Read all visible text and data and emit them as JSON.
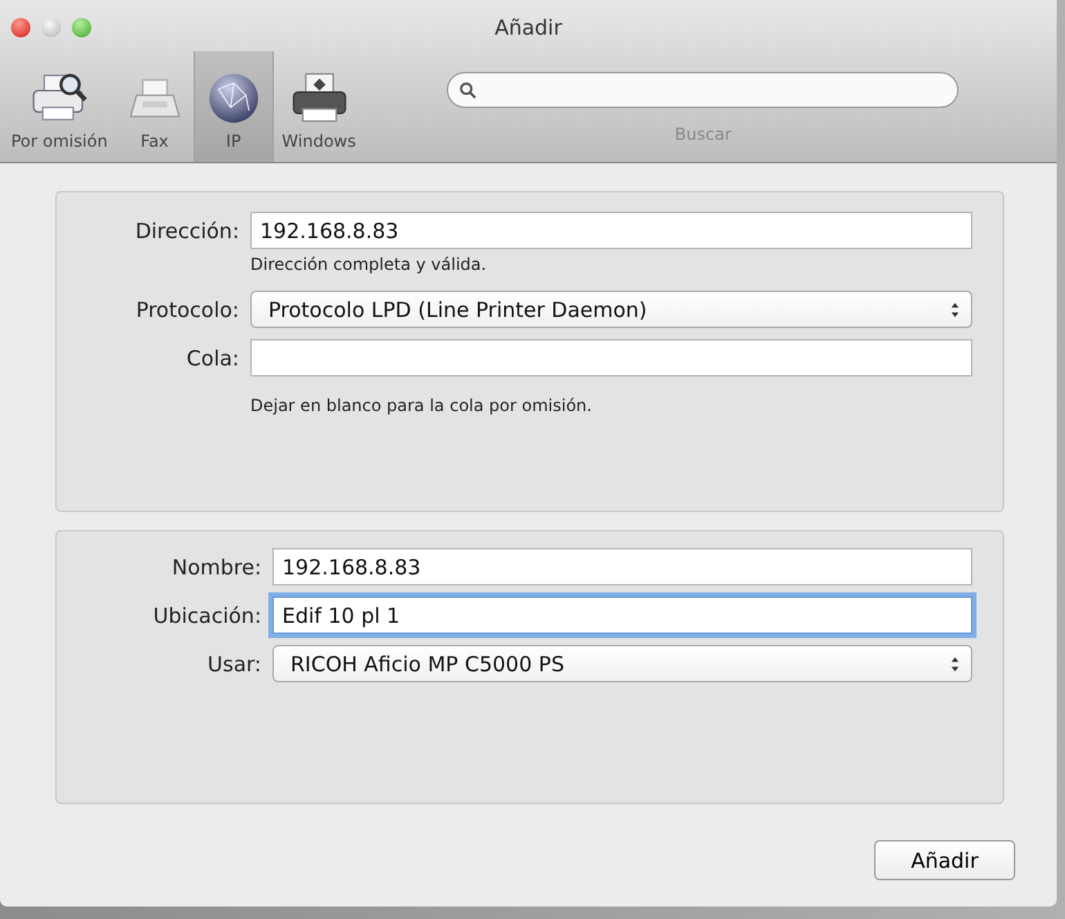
{
  "window": {
    "title": "Añadir"
  },
  "toolbar": {
    "items": [
      {
        "label": "Por omisión",
        "kind": "printer-search",
        "selected": false
      },
      {
        "label": "Fax",
        "kind": "fax",
        "selected": false
      },
      {
        "label": "IP",
        "kind": "globe",
        "selected": true
      },
      {
        "label": "Windows",
        "kind": "windows-printer",
        "selected": false
      }
    ],
    "search": {
      "label": "Buscar"
    }
  },
  "sections": [
    {
      "fields": [
        {
          "label": "Dirección:",
          "kind": "text",
          "value": "192.168.8.83",
          "focused": false,
          "hint": "Dirección completa y válida."
        },
        {
          "label": "Protocolo:",
          "kind": "popup",
          "value": "Protocolo LPD (Line Printer Daemon)"
        },
        {
          "label": "Cola:",
          "kind": "text",
          "focused": false,
          "hint": "Dejar en blanco para la cola por omisión."
        }
      ]
    },
    {
      "fields": [
        {
          "label": "Nombre:",
          "kind": "text",
          "value": "192.168.8.83",
          "focused": false
        },
        {
          "label": "Ubicación:",
          "kind": "text",
          "value": "Edif 10 pl 1",
          "focused": true
        },
        {
          "label": "Usar:",
          "kind": "popup",
          "value": "RICOH Aficio MP C5000 PS"
        }
      ]
    }
  ],
  "buttons": [
    "Añadir"
  ]
}
